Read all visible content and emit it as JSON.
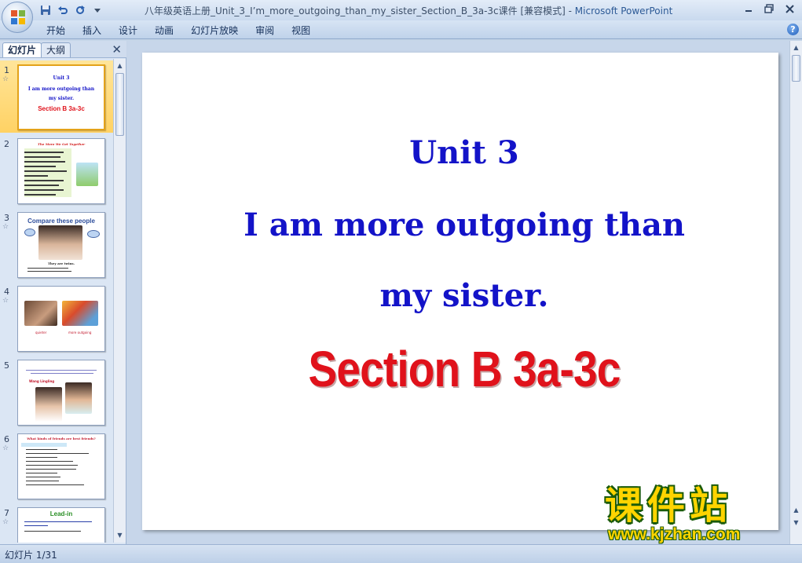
{
  "window": {
    "title_doc": "八年级英语上册_Unit_3_I’m_more_outgoing_than_my_sister_Section_B_3a-3c课件 [兼容模式]",
    "title_separator": " - ",
    "title_app": "Microsoft PowerPoint"
  },
  "quick_access": [
    "save-icon",
    "undo-icon",
    "redo-icon",
    "customize-icon"
  ],
  "ribbon": {
    "tabs": [
      "开始",
      "插入",
      "设计",
      "动画",
      "幻灯片放映",
      "审阅",
      "视图"
    ],
    "help": "?"
  },
  "pane": {
    "tab_slides": "幻灯片",
    "tab_outline": "大纲",
    "close": "✕"
  },
  "thumbnails": [
    {
      "num": "1",
      "title": "Unit 3",
      "line1": "I am more outgoing than",
      "line2": "my sister.",
      "line3": "Section B 3a-3c"
    },
    {
      "num": "2",
      "title": "The More We Get Together"
    },
    {
      "num": "3",
      "title": "Compare these people",
      "caption": "They are twins."
    },
    {
      "num": "4",
      "left_label": "quieter",
      "right_label": "more outgoing"
    },
    {
      "num": "5",
      "title": "Wang Lingling"
    },
    {
      "num": "6",
      "title": "What kinds of friends are best friends?"
    },
    {
      "num": "7",
      "title": "Lead-in"
    }
  ],
  "slide": {
    "unit": "Unit 3",
    "line1": "I am more outgoing than",
    "line2": "my sister.",
    "section": "Section B 3a-3c"
  },
  "watermark": {
    "cn": "课件站",
    "url": "www.kjzhan.com"
  },
  "status": {
    "slide_counter": "幻灯片 1/31"
  },
  "colors": {
    "title_blue": "#1313c8",
    "section_red": "#e0121b",
    "selected_thumb": "#ffd264"
  }
}
